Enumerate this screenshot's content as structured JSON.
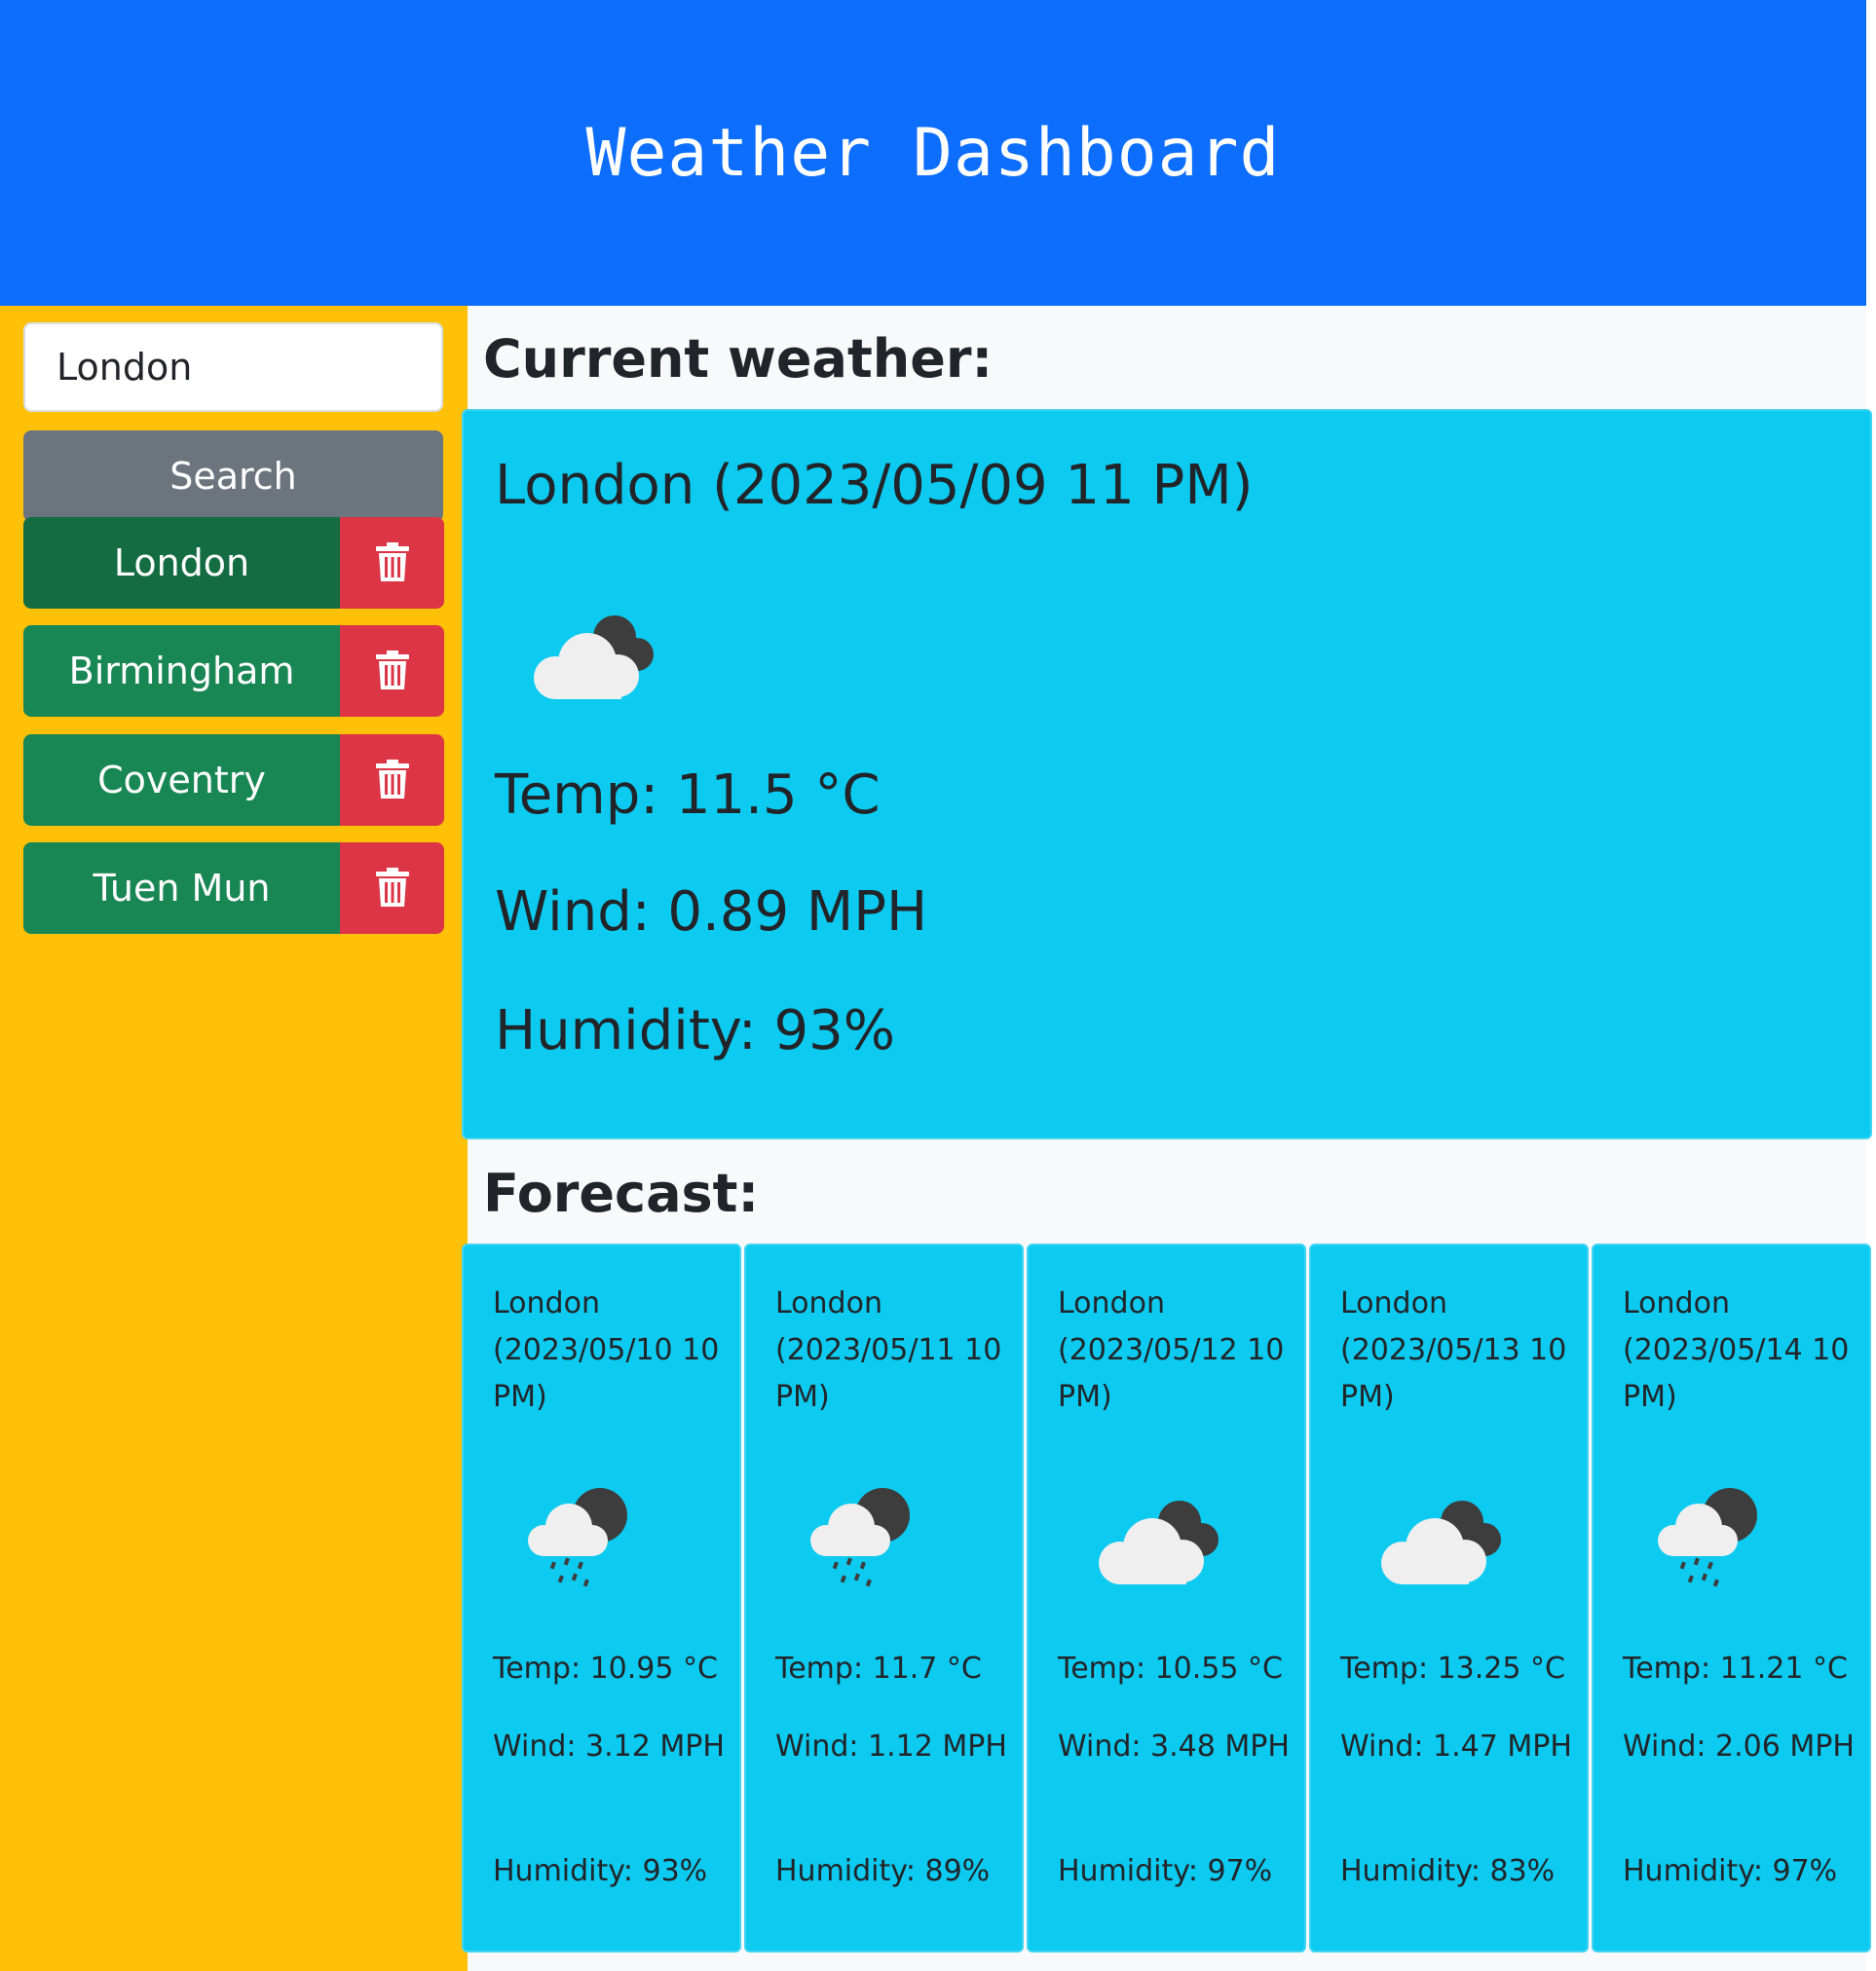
{
  "header": {
    "title": "Weather Dashboard"
  },
  "sidebar": {
    "search_value": "London",
    "search_button": "Search",
    "history": [
      "London",
      "Birmingham",
      "Coventry",
      "Tuen Mun"
    ],
    "delete_icon": "trash-icon"
  },
  "current": {
    "section_title": "Current weather:",
    "title": "London (2023/05/09 11 PM)",
    "icon": "cloudy-icon",
    "temp": "Temp: 11.5 °C",
    "wind": "Wind: 0.89 MPH",
    "humidity": "Humidity: 93%"
  },
  "forecast": {
    "section_title": "Forecast:",
    "days": [
      {
        "title": "London (2023/05/10 10 PM)",
        "icon": "rain-icon",
        "temp": "Temp: 10.95 °C",
        "wind": "Wind: 3.12 MPH",
        "humidity": "Humidity: 93%"
      },
      {
        "title": "London (2023/05/11 10 PM)",
        "icon": "rain-icon",
        "temp": "Temp: 11.7 °C",
        "wind": "Wind: 1.12 MPH",
        "humidity": "Humidity: 89%"
      },
      {
        "title": "London (2023/05/12 10 PM)",
        "icon": "cloudy-icon",
        "temp": "Temp: 10.55 °C",
        "wind": "Wind: 3.48 MPH",
        "humidity": "Humidity: 97%"
      },
      {
        "title": "London (2023/05/13 10 PM)",
        "icon": "cloudy-icon",
        "temp": "Temp: 13.25 °C",
        "wind": "Wind: 1.47 MPH",
        "humidity": "Humidity: 83%"
      },
      {
        "title": "London (2023/05/14 10 PM)",
        "icon": "rain-icon",
        "temp": "Temp: 11.21 °C",
        "wind": "Wind: 2.06 MPH",
        "humidity": "Humidity: 97%"
      }
    ]
  },
  "colors": {
    "header_bg": "#0d6efd",
    "sidebar_bg": "#ffc107",
    "card_bg": "#0dcaf0",
    "city_button": "#198754",
    "delete_button": "#dc3545",
    "search_button": "#6c757d"
  }
}
